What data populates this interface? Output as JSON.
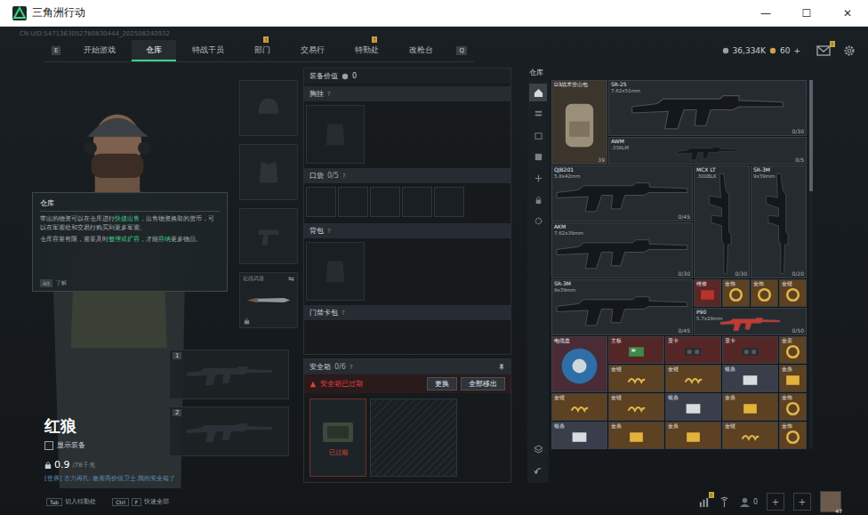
{
  "window": {
    "title": "三角洲行动",
    "controls": [
      "—",
      "☐",
      "✕"
    ]
  },
  "uid": "CN UID:5471363052780830444_202508240932",
  "nav": {
    "prev_key": "E",
    "next_key": "Q",
    "tabs": [
      {
        "label": "开始游戏",
        "selected": false,
        "badge": ""
      },
      {
        "label": "仓库",
        "selected": true,
        "badge": ""
      },
      {
        "label": "特战干员",
        "selected": false,
        "badge": ""
      },
      {
        "label": "部门",
        "selected": false,
        "badge": "!"
      },
      {
        "label": "交易行",
        "selected": false,
        "badge": ""
      },
      {
        "label": "特勤处",
        "selected": false,
        "badge": "!"
      },
      {
        "label": "改枪台",
        "selected": false,
        "badge": ""
      }
    ]
  },
  "currency": {
    "coins": "36,334K",
    "tickets": "60",
    "add": "+"
  },
  "mail": {
    "badge": "!"
  },
  "tooltip": {
    "title": "仓库",
    "lines": [
      [
        {
          "text": "带出的物资可以在仓库进行",
          "highlight": false
        },
        {
          "text": "快捷出售",
          "highlight": true
        },
        {
          "text": "，出售物资换取的货币，可以在军需处和交易行购买到更多军需。",
          "highlight": false
        }
      ],
      [
        {
          "text": "仓库容量有限，需要及时",
          "highlight": false
        },
        {
          "text": "整理或扩容",
          "highlight": true
        },
        {
          "text": "，才能",
          "highlight": false
        },
        {
          "text": "容纳",
          "highlight": true
        },
        {
          "text": "更多物品。",
          "highlight": false
        }
      ]
    ],
    "key": "Alt",
    "hint": "了解"
  },
  "operator": {
    "name": "红狼",
    "show_gear": {
      "label": "显示装备",
      "checked": false
    },
    "weight": "0.9",
    "weight_max": "/78千克"
  },
  "chat": "[世界] 古力再扎: 急需高价值卫士,我的安全箱了",
  "equip_slots": [
    {
      "kind": "helmet",
      "label": "",
      "swap": ""
    },
    {
      "kind": "armor",
      "label": "",
      "swap": ""
    },
    {
      "kind": "pistol",
      "label": "",
      "swap": ""
    },
    {
      "kind": "melee",
      "label": "近战武器",
      "swap": "⇆"
    }
  ],
  "weapon_slots": [
    {
      "index": "1"
    },
    {
      "index": "2"
    }
  ],
  "loadout": {
    "value_label": "装备价值",
    "value": "0",
    "sections": [
      {
        "title": "胸挂",
        "count": "",
        "help": "?",
        "kind": "single",
        "cells": 1
      },
      {
        "title": "口袋",
        "count": "0/5",
        "help": "?",
        "kind": "pockets",
        "cells": 5
      },
      {
        "title": "背包",
        "count": "",
        "help": "?",
        "kind": "single",
        "cells": 1
      },
      {
        "title": "门禁卡包",
        "count": "",
        "help": "?",
        "kind": "header",
        "cells": 0
      }
    ]
  },
  "safebox": {
    "title": "安全箱",
    "count": "0/6",
    "help": "?",
    "expired": true,
    "warning": "安全箱已过期",
    "buttons": [
      "更换",
      "全部移出"
    ],
    "item_label": "已过期"
  },
  "warehouse": {
    "title": "仓库",
    "scroll_level": 0.3,
    "sidebar": [
      {
        "kind": "home",
        "selected": true
      },
      {
        "kind": "list",
        "selected": false
      },
      {
        "kind": "case",
        "selected": false
      },
      {
        "kind": "box",
        "selected": false
      },
      {
        "kind": "plus",
        "selected": false
      },
      {
        "kind": "lock",
        "selected": false
      },
      {
        "kind": "gear",
        "selected": false
      }
    ],
    "sidebar_bottom": [
      {
        "kind": "layers"
      },
      {
        "kind": "back"
      }
    ],
    "items": [
      {
        "name": "D3战术登山包",
        "sub": "",
        "count": "39",
        "kind": "backpack",
        "color": "#3b352c"
      },
      {
        "name": "SR-25",
        "sub": "7.62x51mm",
        "count": "0/30",
        "kind": "long",
        "color": "#262b30"
      },
      {
        "name": "AWM",
        "sub": ".338LM",
        "count": "0/5",
        "kind": "sniper",
        "color": "#262b30"
      },
      {
        "name": "QJB201",
        "sub": "5.8x42mm",
        "count": "0/45",
        "kind": "rifle",
        "color": "#262b30"
      },
      {
        "name": "MCX LT",
        "sub": ".300BLK",
        "count": "0/30",
        "kind": "vertical",
        "color": "#262b30"
      },
      {
        "name": "SR-3M",
        "sub": "9x39mm",
        "count": "0/20",
        "kind": "vertical",
        "color": "#262b30"
      },
      {
        "name": "AKM",
        "sub": "7.62x39mm",
        "count": "0/30",
        "kind": "rifle",
        "color": "#262b30"
      },
      {
        "name": "SR-3M",
        "sub": "9x39mm",
        "count": "0/45",
        "kind": "rifle",
        "color": "#262b30"
      },
      {
        "name": "维修",
        "sub": "",
        "count": "",
        "kind": "red-case",
        "color": "#5a2626"
      },
      {
        "name": "金饰",
        "sub": "",
        "count": "",
        "kind": "gold-ornament",
        "color": "#5c4122"
      },
      {
        "name": "金饰",
        "sub": "",
        "count": "",
        "kind": "gold-ornament",
        "color": "#5c4122"
      },
      {
        "name": "金链",
        "sub": "",
        "count": "",
        "kind": "gold-ornament",
        "color": "#5c4122"
      },
      {
        "name": "P90",
        "sub": "5.7x28mm",
        "count": "0/50",
        "kind": "smg",
        "color": "#262b30"
      },
      {
        "name": "电缆盘",
        "sub": "",
        "count": "",
        "kind": "cable-reel",
        "color": "#4a2c36"
      },
      {
        "name": "主板",
        "sub": "",
        "count": "",
        "kind": "board",
        "color": "#552626"
      },
      {
        "name": "显卡",
        "sub": "",
        "count": "",
        "kind": "gpu",
        "color": "#552626"
      },
      {
        "name": "显卡",
        "sub": "",
        "count": "",
        "kind": "gpu",
        "color": "#552626"
      },
      {
        "name": "金表",
        "sub": "",
        "count": "",
        "kind": "gold-ornament",
        "color": "#5c4122"
      },
      {
        "name": "金链",
        "sub": "",
        "count": "",
        "kind": "gold-chain",
        "color": "#5c4122"
      },
      {
        "name": "金链",
        "sub": "",
        "count": "",
        "kind": "gold-chain",
        "color": "#5c4122"
      },
      {
        "name": "银条",
        "sub": "",
        "count": "",
        "kind": "silver-bar",
        "color": "#3a3e4a"
      },
      {
        "name": "金条",
        "sub": "",
        "count": "",
        "kind": "gold-ingot",
        "color": "#5c4122"
      },
      {
        "name": "金链",
        "sub": "",
        "count": "",
        "kind": "gold-chain",
        "color": "#5c4122"
      },
      {
        "name": "金链",
        "sub": "",
        "count": "",
        "kind": "gold-chain",
        "color": "#5c4122"
      },
      {
        "name": "银条",
        "sub": "",
        "count": "",
        "kind": "silver-bar",
        "color": "#3a3e4a"
      },
      {
        "name": "金条",
        "sub": "",
        "count": "",
        "kind": "gold-bar",
        "color": "#5c4122"
      },
      {
        "name": "金饰",
        "sub": "",
        "count": "",
        "kind": "gold-ornament",
        "color": "#5c4122"
      },
      {
        "name": "银条",
        "sub": "",
        "count": "",
        "kind": "silver-bar",
        "color": "#3a3e4a"
      },
      {
        "name": "金条",
        "sub": "",
        "count": "",
        "kind": "gold-bar",
        "color": "#5c4122"
      },
      {
        "name": "金条",
        "sub": "",
        "count": "",
        "kind": "gold-bar",
        "color": "#5c4122"
      },
      {
        "name": "金链",
        "sub": "",
        "count": "",
        "kind": "gold-chain",
        "color": "#5c4122"
      },
      {
        "name": "金饰",
        "sub": "",
        "count": "",
        "kind": "gold-ornament",
        "color": "#5c4122"
      }
    ]
  },
  "hints": [
    {
      "keys": [
        "Tab"
      ],
      "label": "切入特勤处"
    },
    {
      "keys": [
        "Ctrl",
        "F"
      ],
      "label": "快速全部"
    }
  ],
  "bottom_right": {
    "stats_badge": "!",
    "friends": "0",
    "plus": [
      "+",
      "+"
    ],
    "level": "47"
  }
}
